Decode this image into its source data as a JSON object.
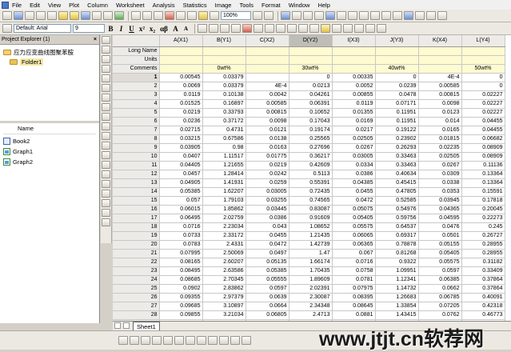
{
  "menu": [
    "File",
    "Edit",
    "View",
    "Plot",
    "Column",
    "Worksheet",
    "Analysis",
    "Statistics",
    "Image",
    "Tools",
    "Format",
    "Window",
    "Help"
  ],
  "toolbar": {
    "zoom": "100%",
    "font_name": "Default: Arial",
    "font_size": "9"
  },
  "format_buttons": [
    "B",
    "I",
    "U",
    "x²",
    "x₂",
    "αβ",
    "A",
    "A"
  ],
  "project_explorer": {
    "title": "Project Explorer (1)",
    "root_folder": "应力应变曲线图聚苯胺",
    "sub_folder": "Folder1",
    "list_header": "Name",
    "items": [
      {
        "name": "Book2",
        "kind": "book"
      },
      {
        "name": "Graph1",
        "kind": "graph"
      },
      {
        "name": "Graph2",
        "kind": "graph"
      }
    ]
  },
  "columns": [
    "A(X1)",
    "B(Y1)",
    "C(X2)",
    "D(Y2)",
    "I(X3)",
    "J(Y3)",
    "K(X4)",
    "L(Y4)"
  ],
  "selected_column": 3,
  "meta_rows": [
    {
      "label": "Long Name",
      "values": [
        "",
        "",
        "",
        "",
        "",
        "",
        "",
        ""
      ]
    },
    {
      "label": "Units",
      "values": [
        "",
        "",
        "",
        "",
        "",
        "",
        "",
        ""
      ]
    },
    {
      "label": "Comments",
      "values": [
        "",
        "0wt%",
        "",
        "30wt%",
        "",
        "40wt%",
        "",
        "50wt%"
      ]
    }
  ],
  "rows": [
    [
      "0.00545",
      "0.03379",
      "",
      "0",
      "0.00335",
      "0",
      "4E-4",
      "0"
    ],
    [
      "0.0069",
      "0.03379",
      "4E-4",
      "0.0213",
      "0.0052",
      "0.0239",
      "0.00585",
      "0"
    ],
    [
      "0.0119",
      "0.10138",
      "0.0042",
      "0.04261",
      "0.00855",
      "0.0478",
      "0.00815",
      "0.02227"
    ],
    [
      "0.01525",
      "0.16897",
      "0.00585",
      "0.06391",
      "0.0119",
      "0.07171",
      "0.0098",
      "0.02227"
    ],
    [
      "0.0219",
      "0.33793",
      "0.00815",
      "0.10652",
      "0.01355",
      "0.11951",
      "0.0123",
      "0.02227"
    ],
    [
      "0.0236",
      "0.37172",
      "0.0098",
      "0.17043",
      "0.0169",
      "0.11951",
      "0.014",
      "0.04455"
    ],
    [
      "0.02715",
      "0.4731",
      "0.0121",
      "0.19174",
      "0.0217",
      "0.19122",
      "0.0165",
      "0.04455"
    ],
    [
      "0.03215",
      "0.67586",
      "0.0138",
      "0.25565",
      "0.02505",
      "0.23902",
      "0.01815",
      "0.06682"
    ],
    [
      "0.03905",
      "0.98",
      "0.0163",
      "0.27696",
      "0.0267",
      "0.26293",
      "0.02235",
      "0.08909"
    ],
    [
      "0.0407",
      "1.11517",
      "0.01775",
      "0.36217",
      "0.03005",
      "0.33463",
      "0.02505",
      "0.08909"
    ],
    [
      "0.04405",
      "1.21655",
      "0.0219",
      "0.42609",
      "0.0334",
      "0.33463",
      "0.0267",
      "0.11136"
    ],
    [
      "0.0457",
      "1.28414",
      "0.0242",
      "0.5113",
      "0.0386",
      "0.40634",
      "0.0309",
      "0.13364"
    ],
    [
      "0.04905",
      "1.41931",
      "0.0259",
      "0.55391",
      "0.04385",
      "0.45415",
      "0.0338",
      "0.13364"
    ],
    [
      "0.05385",
      "1.62207",
      "0.03005",
      "0.72435",
      "0.0455",
      "0.47805",
      "0.0353",
      "0.15591"
    ],
    [
      "0.057",
      "1.79103",
      "0.03255",
      "0.74565",
      "0.0472",
      "0.52585",
      "0.03945",
      "0.17818"
    ],
    [
      "0.06015",
      "1.85862",
      "0.03445",
      "0.83087",
      "0.05075",
      "0.54976",
      "0.04365",
      "0.20045"
    ],
    [
      "0.06495",
      "2.02759",
      "0.0386",
      "0.91609",
      "0.05405",
      "0.59756",
      "0.04595",
      "0.22273"
    ],
    [
      "0.0716",
      "2.23034",
      "0.043",
      "1.08652",
      "0.05575",
      "0.64537",
      "0.0476",
      "0.245"
    ],
    [
      "0.0733",
      "2.33172",
      "0.0455",
      "1.21435",
      "0.06065",
      "0.69317",
      "0.0501",
      "0.26727"
    ],
    [
      "0.0783",
      "2.4331",
      "0.0472",
      "1.42739",
      "0.06365",
      "0.78878",
      "0.05155",
      "0.28955"
    ],
    [
      "0.07995",
      "2.50069",
      "0.0497",
      "1.47",
      "0.067",
      "0.81268",
      "0.05405",
      "0.28955"
    ],
    [
      "0.08165",
      "2.60207",
      "0.05135",
      "1.66174",
      "0.0716",
      "0.9322",
      "0.05575",
      "0.31182"
    ],
    [
      "0.08495",
      "2.63586",
      "0.05385",
      "1.70435",
      "0.0758",
      "1.09951",
      "0.0597",
      "0.33409"
    ],
    [
      "0.08685",
      "2.70345",
      "0.05555",
      "1.89609",
      "0.0781",
      "1.12341",
      "0.06385",
      "0.37864"
    ],
    [
      "0.0902",
      "2.83862",
      "0.0597",
      "2.02391",
      "0.07975",
      "1.14732",
      "0.0662",
      "0.37864"
    ],
    [
      "0.09355",
      "2.97379",
      "0.0639",
      "2.30087",
      "0.08395",
      "1.26683",
      "0.06785",
      "0.40091"
    ],
    [
      "0.09685",
      "3.10897",
      "0.0664",
      "2.34348",
      "0.08645",
      "1.33854",
      "0.07205",
      "0.42318"
    ],
    [
      "0.09855",
      "3.21034",
      "0.06805",
      "2.4713",
      "0.0881",
      "1.43415",
      "0.0762",
      "0.46773"
    ],
    [
      "0.1052",
      "3.51448",
      "0.07225",
      "2.57783",
      "0.0906",
      "1.50585",
      "0.07785",
      "0.49"
    ],
    [
      "0.1069",
      "3.58207",
      "0.0764",
      "2.79087",
      "0.0931",
      "1.59",
      "0.0812",
      "0.51"
    ]
  ],
  "sheet_tab": "Sheet1",
  "watermark": "www.jtjt.cn软荐网"
}
